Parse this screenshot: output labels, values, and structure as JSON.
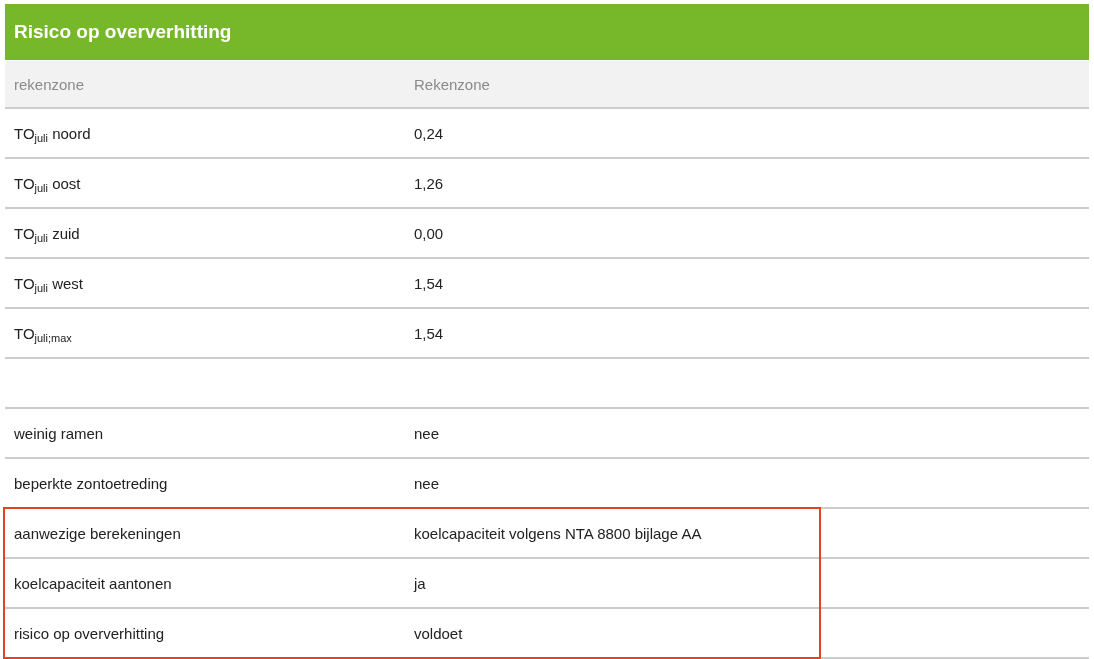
{
  "panel": {
    "title": "Risico op oververhitting",
    "header": {
      "label": "rekenzone",
      "value": "Rekenzone"
    },
    "rows": [
      {
        "kind": "data",
        "label": "TO$_{juli}$ noord",
        "value": "0,24",
        "highlighted": false
      },
      {
        "kind": "data",
        "label": "TO$_{juli}$ oost",
        "value": "1,26",
        "highlighted": false
      },
      {
        "kind": "data",
        "label": "TO$_{juli}$ zuid",
        "value": "0,00",
        "highlighted": false
      },
      {
        "kind": "data",
        "label": "TO$_{juli}$ west",
        "value": "1,54",
        "highlighted": false
      },
      {
        "kind": "data",
        "label": "TO$_{juli;max}$",
        "value": "1,54",
        "highlighted": false
      },
      {
        "kind": "spacer"
      },
      {
        "kind": "data",
        "label": "weinig ramen",
        "value": "nee",
        "highlighted": false
      },
      {
        "kind": "data",
        "label": "beperkte zontoetreding",
        "value": "nee",
        "highlighted": false
      },
      {
        "kind": "data",
        "label": "aanwezige berekeningen",
        "value": "koelcapaciteit volgens NTA 8800 bijlage AA",
        "highlighted": true
      },
      {
        "kind": "data",
        "label": "koelcapaciteit aantonen",
        "value": "ja",
        "highlighted": true
      },
      {
        "kind": "data",
        "label": "risico op oververhitting",
        "value": "voldoet",
        "highlighted": true
      }
    ]
  }
}
